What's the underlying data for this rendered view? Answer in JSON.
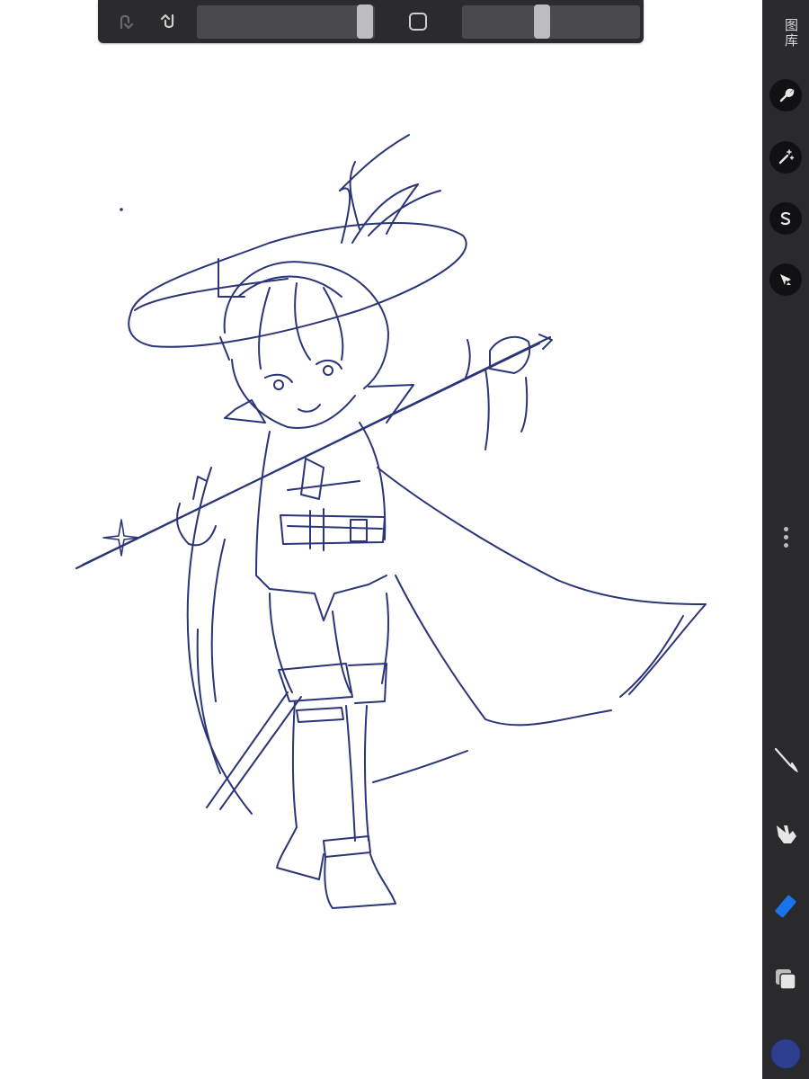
{
  "app": {
    "sidebar": {
      "gallery_label": "图库",
      "tools": [
        {
          "name": "actions",
          "icon": "wrench-icon"
        },
        {
          "name": "adjustments",
          "icon": "magic-wand-icon"
        },
        {
          "name": "selection",
          "icon": "selection-s-icon"
        },
        {
          "name": "transform",
          "icon": "arrow-cursor-icon"
        }
      ],
      "paint_tools": [
        {
          "name": "brush",
          "icon": "brush-icon",
          "active": false
        },
        {
          "name": "smudge",
          "icon": "smudge-finger-icon",
          "active": false
        },
        {
          "name": "eraser",
          "icon": "eraser-icon",
          "active": true
        },
        {
          "name": "layers",
          "icon": "layers-icon",
          "active": false
        }
      ],
      "current_color": "#2d3f8c"
    },
    "toolbar": {
      "undo_icon": "undo-icon",
      "redo_icon": "redo-icon",
      "modify_icon": "square-icon",
      "brush_size_level": 0.9,
      "opacity_level": 0.45
    },
    "colors": {
      "accent_blue": "#1a73e8",
      "sketch_stroke": "#2b3578",
      "sidebar_bg": "#2a2a2c"
    },
    "canvas": {
      "content": "sketch-of-chibi-musketeer"
    }
  }
}
